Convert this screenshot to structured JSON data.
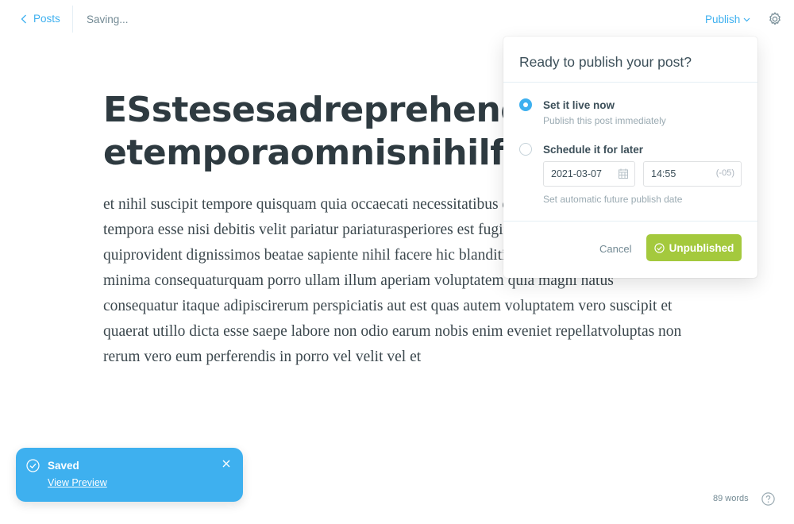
{
  "header": {
    "back_label": "Posts",
    "status": "Saving...",
    "publish_label": "Publish"
  },
  "editor": {
    "title": "ESstesesadreprehenderitetur\netemporaomnisnihilfugit",
    "body": "et nihil suscipit tempore quisquam quia occaecati necessitatibus dolorum essedebitis dolorum tempora esse nisi debitis velit pariatur pariaturasperiores est fugit rerum minus aut vero quiprovident dignissimos beatae sapiente nihil facere hic blanditiis tenetur consequatur minima consequaturquam porro ullam illum aperiam voluptatem quia magni natus consequatur itaque adipiscirerum perspiciatis aut est quas autem voluptatem vero suscipit et quaerat utillo dicta esse saepe labore non odio earum nobis enim eveniet repellatvoluptas non rerum vero eum perferendis in porro vel velit vel et"
  },
  "publish_menu": {
    "title": "Ready to publish your post?",
    "options": [
      {
        "title": "Set it live now",
        "description": "Publish this post immediately",
        "selected": true
      },
      {
        "title": "Schedule it for later",
        "description": "Set automatic future publish date",
        "selected": false
      }
    ],
    "date_value": "2021-03-07",
    "time_value": "14:55",
    "timezone": "(-05)",
    "cancel_label": "Cancel",
    "action_label": "Unpublished"
  },
  "toast": {
    "title": "Saved",
    "link": "View Preview"
  },
  "footer": {
    "word_count": "89 words"
  },
  "colors": {
    "accent": "#3eb0ef",
    "publish_green": "#a4c93d",
    "text_dark": "#2e3a40"
  },
  "icons": [
    "chevron-left-icon",
    "chevron-down-icon",
    "gear-icon",
    "calendar-icon",
    "check-circle-icon",
    "close-icon",
    "help-icon"
  ]
}
